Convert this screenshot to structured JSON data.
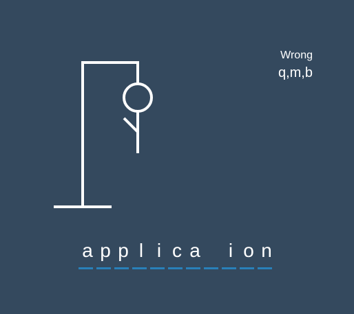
{
  "game": {
    "wrong_label": "Wrong",
    "wrong_letters": "q,m,b",
    "word_slots": [
      "a",
      "p",
      "p",
      "l",
      "i",
      "c",
      "a",
      "",
      "i",
      "o",
      "n"
    ],
    "wrong_guess_count": 3
  },
  "colors": {
    "background": "#34495e",
    "figure": "#ffffff",
    "underline": "#2980b9",
    "text": "#ffffff"
  }
}
